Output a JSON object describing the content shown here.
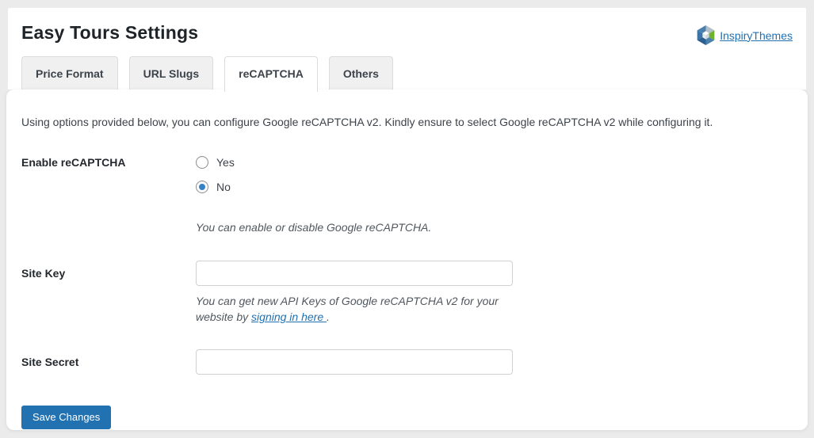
{
  "page": {
    "title": "Easy Tours Settings"
  },
  "header": {
    "brand_link": " InspiryThemes"
  },
  "tabs": [
    {
      "label": "Price Format",
      "active": false
    },
    {
      "label": "URL Slugs",
      "active": false
    },
    {
      "label": "reCAPTCHA",
      "active": true
    },
    {
      "label": "Others",
      "active": false
    }
  ],
  "content": {
    "description": "Using options provided below, you can configure Google reCAPTCHA v2. Kindly ensure to select Google reCAPTCHA v2 while configuring it.",
    "enable_field": {
      "label": "Enable reCAPTCHA",
      "options": [
        {
          "label": "Yes",
          "selected": false
        },
        {
          "label": "No",
          "selected": true
        }
      ],
      "help": "You can enable or disable Google reCAPTCHA."
    },
    "site_key_field": {
      "label": "Site Key",
      "value": "",
      "help_prefix": "You can get new API Keys of Google reCAPTCHA v2 for your website by ",
      "help_link": "signing in here ",
      "help_suffix": "."
    },
    "site_secret_field": {
      "label": "Site Secret",
      "value": ""
    },
    "save_label": "Save Changes"
  },
  "colors": {
    "accent_blue": "#2271b1",
    "radio_selected": "#3582c4",
    "link_blue": "#2271b1",
    "page_background": "#ebebeb",
    "logo_green": "#6fb32c",
    "logo_blue": "#4a7fae"
  }
}
